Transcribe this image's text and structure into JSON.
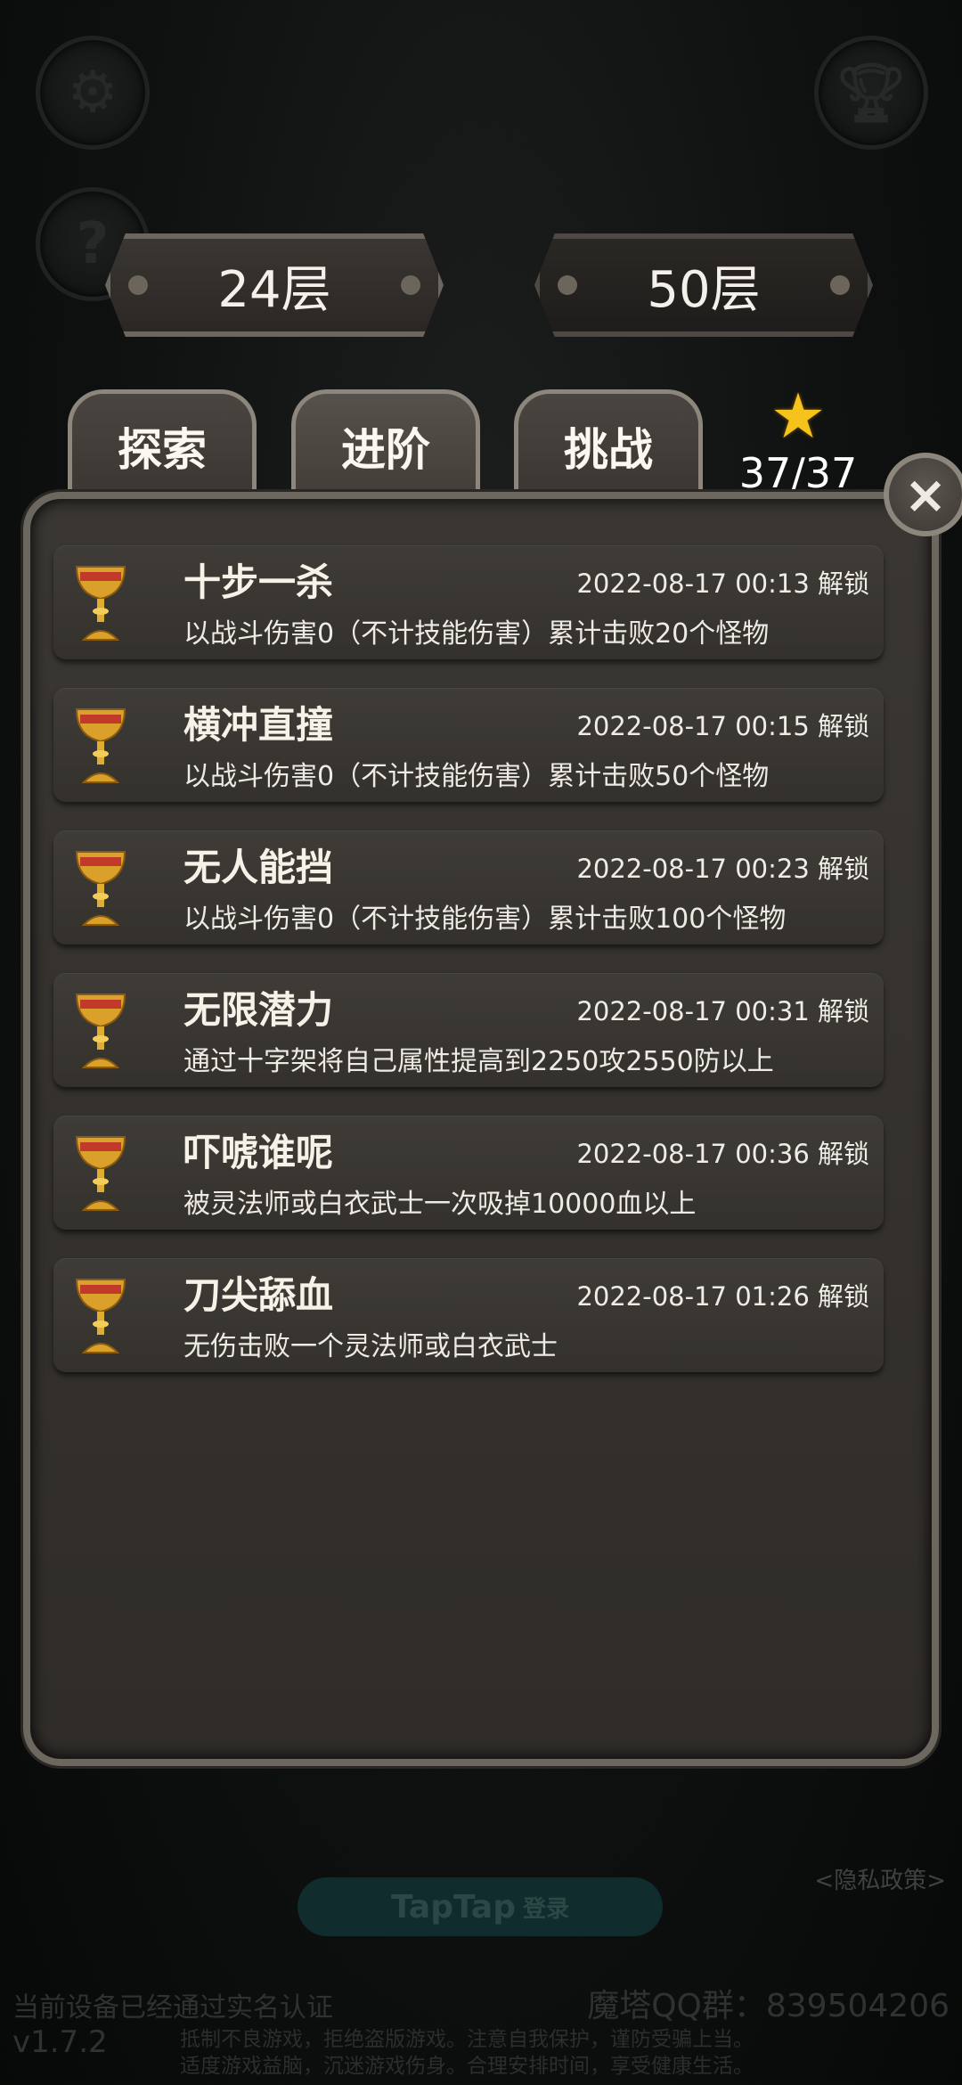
{
  "floors": {
    "current": "24层",
    "max": "50层"
  },
  "tabs": [
    {
      "label": "探索"
    },
    {
      "label": "进阶",
      "active": true
    },
    {
      "label": "挑战"
    }
  ],
  "star_count": "37/37",
  "close_symbol": "×",
  "unlock_label": "解锁",
  "achievements": [
    {
      "name": "十步一杀",
      "date": "2022-08-17 00:13 解锁",
      "desc": "以战斗伤害0（不计技能伤害）累计击败20个怪物"
    },
    {
      "name": "横冲直撞",
      "date": "2022-08-17 00:15 解锁",
      "desc": "以战斗伤害0（不计技能伤害）累计击败50个怪物"
    },
    {
      "name": "无人能挡",
      "date": "2022-08-17 00:23 解锁",
      "desc": "以战斗伤害0（不计技能伤害）累计击败100个怪物"
    },
    {
      "name": "无限潜力",
      "date": "2022-08-17 00:31 解锁",
      "desc": "通过十字架将自己属性提高到2250攻2550防以上"
    },
    {
      "name": "吓唬谁呢",
      "date": "2022-08-17 00:36 解锁",
      "desc": "被灵法师或白衣武士一次吸掉10000血以上"
    },
    {
      "name": "刀尖舔血",
      "date": "2022-08-17 01:26 解锁",
      "desc": "无伤击败一个灵法师或白衣武士"
    }
  ],
  "footer": {
    "taptap_label": "TapTap",
    "login_label": "登录",
    "privacy": "<隐私政策>",
    "realname": "当前设备已经通过实名认证",
    "qq_group": "魔塔QQ群：839504206",
    "version": "v1.7.2",
    "health_line1": "抵制不良游戏，拒绝盗版游戏。注意自我保护，谨防受骗上当。",
    "health_line2": "适度游戏益脑，沉迷游戏伤身。合理安排时间，享受健康生活。"
  },
  "icons": {
    "settings": "gear-icon",
    "help": "question-icon",
    "trophy": "trophy-icon",
    "star": "star-icon",
    "achievement": "golden-chalice-icon"
  },
  "colors": {
    "star": "#f6c21c",
    "panel": "#34312d",
    "frame": "#6d685f"
  }
}
